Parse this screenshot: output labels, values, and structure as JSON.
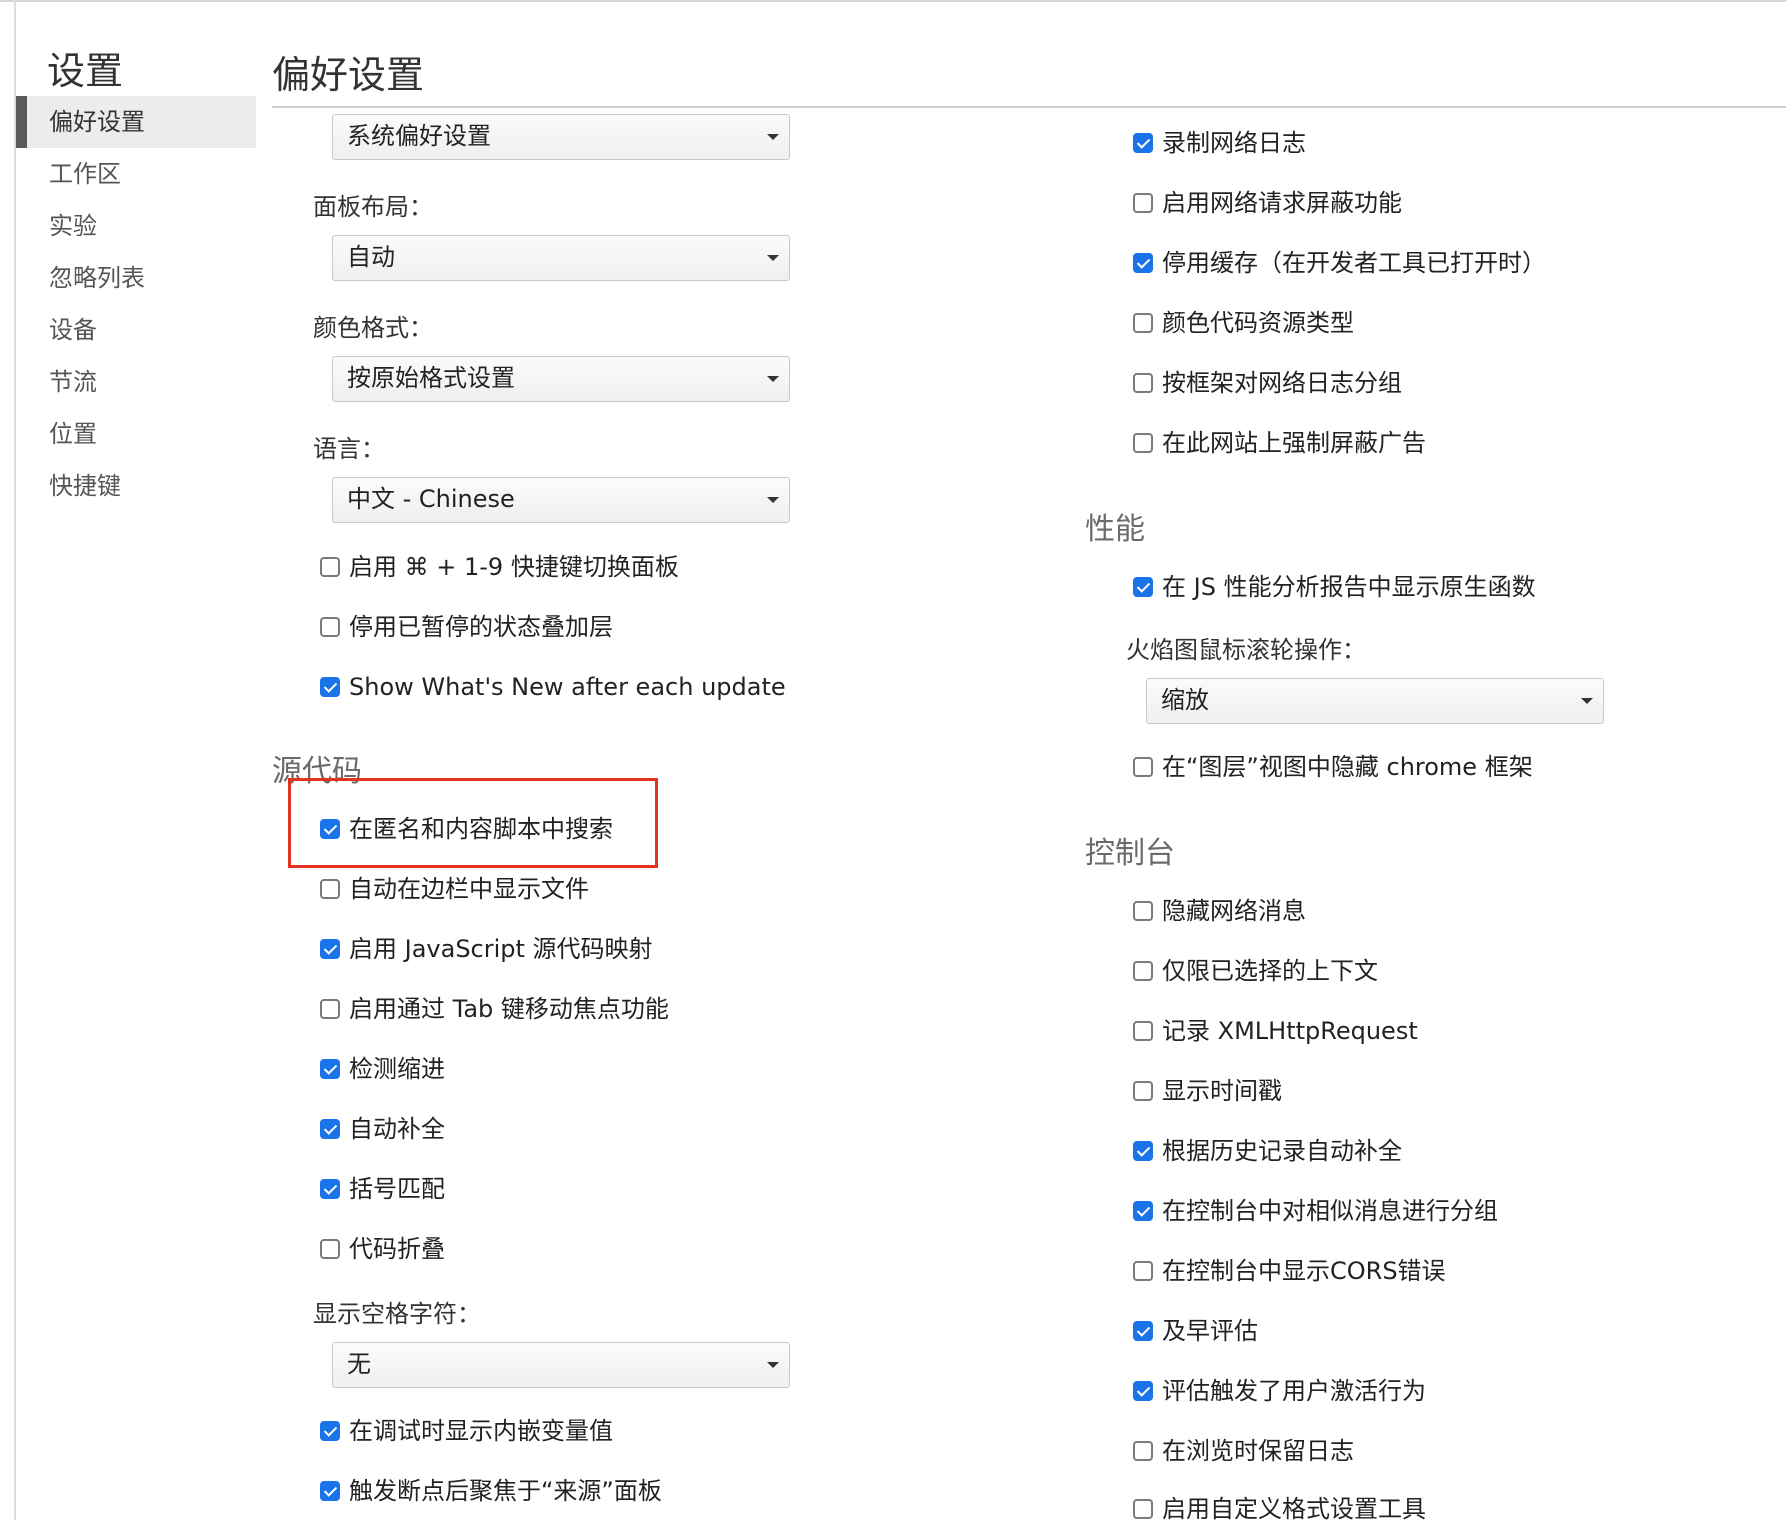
{
  "sidebar": {
    "title": "设置",
    "items": [
      {
        "label": "偏好设置",
        "active": true
      },
      {
        "label": "工作区",
        "active": false
      },
      {
        "label": "实验",
        "active": false
      },
      {
        "label": "忽略列表",
        "active": false
      },
      {
        "label": "设备",
        "active": false
      },
      {
        "label": "节流",
        "active": false
      },
      {
        "label": "位置",
        "active": false
      },
      {
        "label": "快捷键",
        "active": false
      }
    ]
  },
  "header": {
    "title": "偏好设置"
  },
  "left": {
    "theme_select": "系统偏好设置",
    "panel_layout_label": "面板布局：",
    "panel_layout_select": "自动",
    "color_format_label": "颜色格式：",
    "color_format_select": "按原始格式设置",
    "language_label": "语言：",
    "language_select": "中文 - Chinese",
    "checkboxes": [
      {
        "label": "启用 ⌘ + 1-9 快捷键切换面板",
        "checked": false
      },
      {
        "label": "停用已暂停的状态叠加层",
        "checked": false
      },
      {
        "label": "Show What's New after each update",
        "checked": true
      }
    ],
    "sources_title": "源代码",
    "sources_checkboxes": [
      {
        "label": "在匿名和内容脚本中搜索",
        "checked": true
      },
      {
        "label": "自动在边栏中显示文件",
        "checked": false
      },
      {
        "label": "启用 JavaScript 源代码映射",
        "checked": true
      },
      {
        "label": "启用通过 Tab 键移动焦点功能",
        "checked": false
      },
      {
        "label": "检测缩进",
        "checked": true
      },
      {
        "label": "自动补全",
        "checked": true
      },
      {
        "label": "括号匹配",
        "checked": true
      },
      {
        "label": "代码折叠",
        "checked": false
      }
    ],
    "whitespace_label": "显示空格字符：",
    "whitespace_select": "无",
    "sources_checkboxes2": [
      {
        "label": "在调试时显示内嵌变量值",
        "checked": true
      },
      {
        "label": "触发断点后聚焦于“来源”面板",
        "checked": true
      }
    ]
  },
  "right": {
    "network_checkboxes": [
      {
        "label": "录制网络日志",
        "checked": true
      },
      {
        "label": "启用网络请求屏蔽功能",
        "checked": false
      },
      {
        "label": "停用缓存（在开发者工具已打开时）",
        "checked": true
      },
      {
        "label": "颜色代码资源类型",
        "checked": false
      },
      {
        "label": "按框架对网络日志分组",
        "checked": false
      },
      {
        "label": "在此网站上强制屏蔽广告",
        "checked": false
      }
    ],
    "performance_title": "性能",
    "perf_checkbox": {
      "label": "在 JS 性能分析报告中显示原生函数",
      "checked": true
    },
    "flame_label": "火焰图鼠标滚轮操作：",
    "flame_select": "缩放",
    "layers_checkbox": {
      "label": "在“图层”视图中隐藏 chrome 框架",
      "checked": false
    },
    "console_title": "控制台",
    "console_checkboxes": [
      {
        "label": "隐藏网络消息",
        "checked": false
      },
      {
        "label": "仅限已选择的上下文",
        "checked": false
      },
      {
        "label": "记录 XMLHttpRequest",
        "checked": false
      },
      {
        "label": "显示时间戳",
        "checked": false
      },
      {
        "label": "根据历史记录自动补全",
        "checked": true
      },
      {
        "label": "在控制台中对相似消息进行分组",
        "checked": true
      },
      {
        "label": "在控制台中显示CORS错误",
        "checked": false
      },
      {
        "label": "及早评估",
        "checked": true
      },
      {
        "label": "评估触发了用户激活行为",
        "checked": true
      },
      {
        "label": "在浏览时保留日志",
        "checked": false
      },
      {
        "label": "启用自定义格式设置工具",
        "checked": false
      }
    ]
  },
  "colors": {
    "accent": "#1a73e8",
    "highlight": "#e0341f"
  }
}
